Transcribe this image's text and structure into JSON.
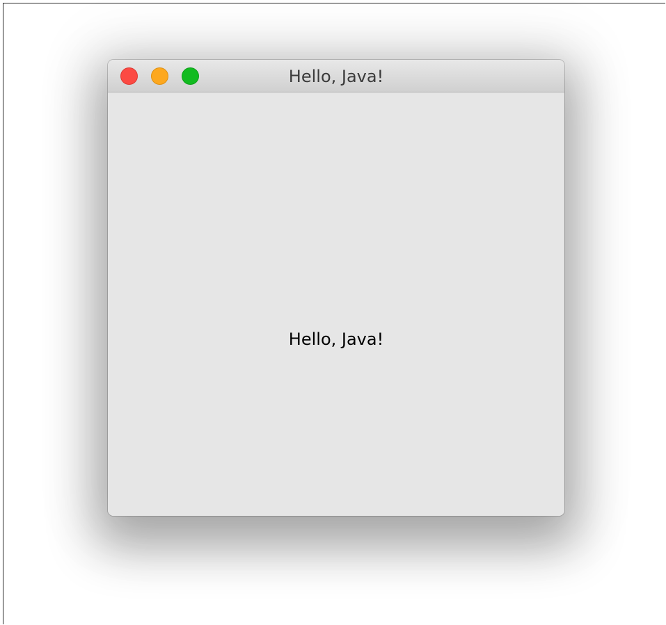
{
  "window": {
    "title": "Hello, Java!",
    "controls": {
      "close_color": "#fc4a43",
      "minimize_color": "#fda81f",
      "maximize_color": "#12bb20"
    }
  },
  "content": {
    "label": "Hello, Java!"
  }
}
